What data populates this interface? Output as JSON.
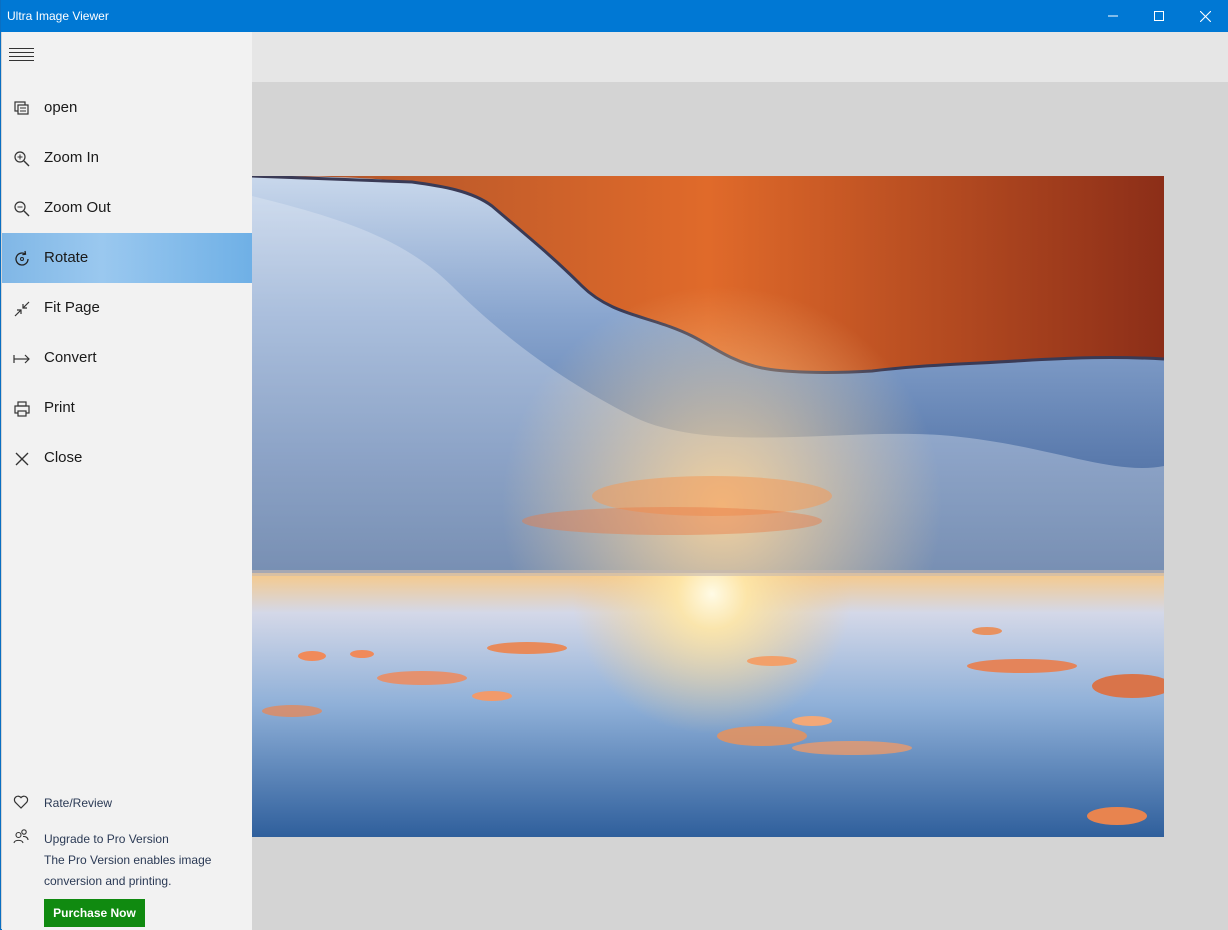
{
  "window": {
    "title": "Ultra Image Viewer",
    "accent_color": "#0078d4",
    "controls": [
      "minimize-icon",
      "maximize-icon",
      "close-icon"
    ]
  },
  "sidebar": {
    "menu_icon": "hamburger-icon",
    "items": [
      {
        "label": "open",
        "icon": "open-icon",
        "active": false
      },
      {
        "label": "Zoom In",
        "icon": "zoom-in-icon",
        "active": false
      },
      {
        "label": "Zoom Out",
        "icon": "zoom-out-icon",
        "active": false
      },
      {
        "label": "Rotate",
        "icon": "rotate-icon",
        "active": true
      },
      {
        "label": "Fit Page",
        "icon": "fit-page-icon",
        "active": false
      },
      {
        "label": "Convert",
        "icon": "convert-icon",
        "active": false
      },
      {
        "label": "Print",
        "icon": "print-icon",
        "active": false
      },
      {
        "label": "Close",
        "icon": "close-icon",
        "active": false
      }
    ],
    "rate_review": {
      "label": "Rate/Review",
      "icon": "heart-icon"
    },
    "upgrade": {
      "label": "Upgrade to Pro Version",
      "icon": "people-icon",
      "description_line1": "The Pro Version enables image",
      "description_line2": "conversion and printing."
    },
    "purchase_button": {
      "label": "Purchase Now",
      "color": "#108a10"
    }
  },
  "viewer": {
    "image_description_icon": "displayed-image",
    "rotated": true
  }
}
